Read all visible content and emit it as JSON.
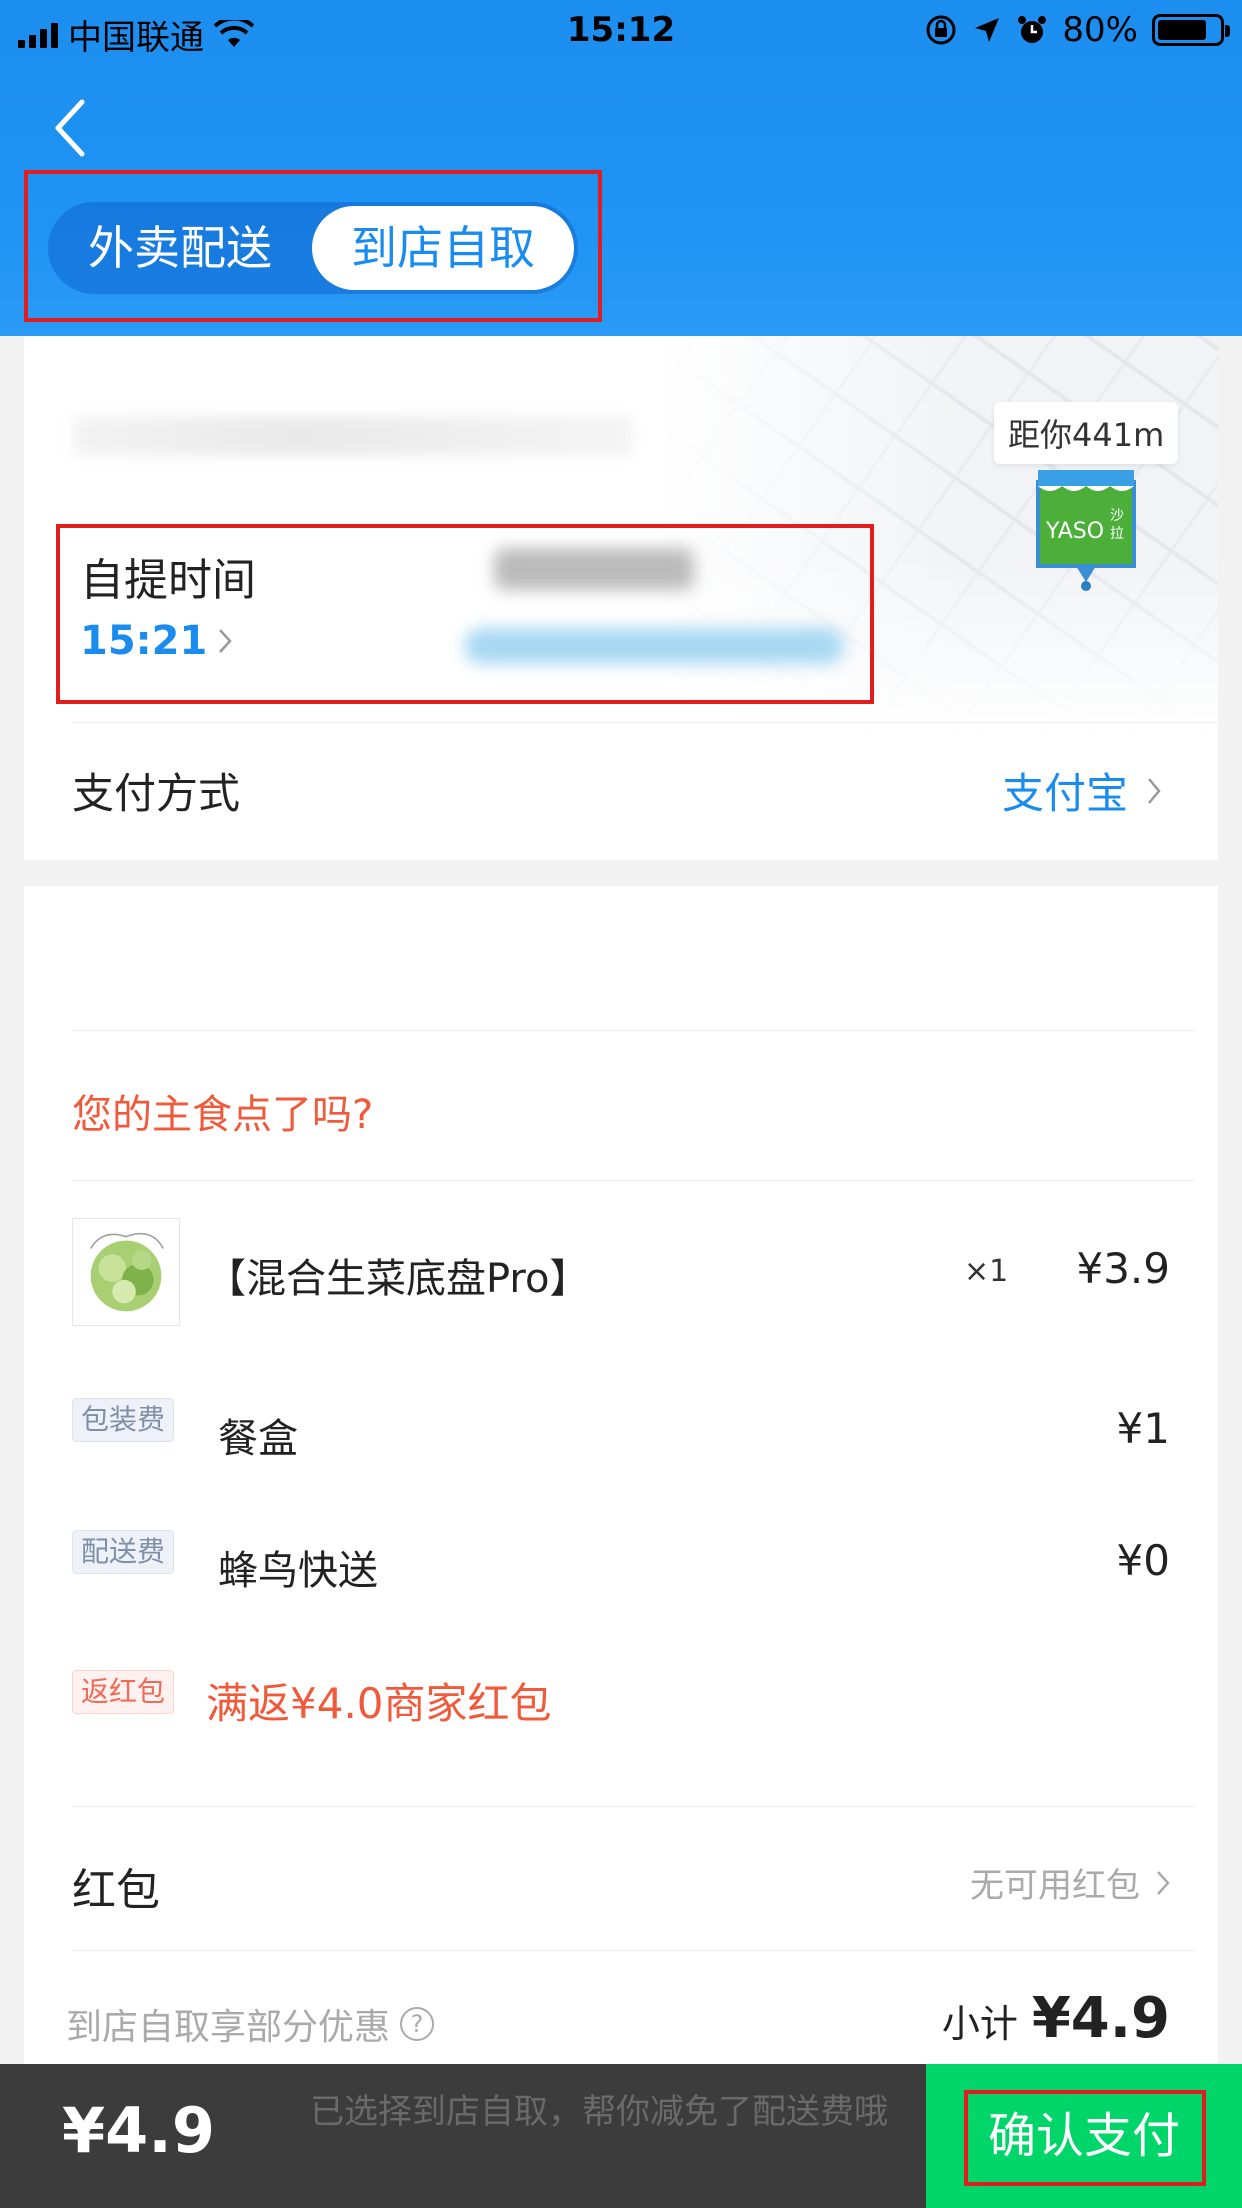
{
  "status_bar": {
    "carrier": "中国联通",
    "time": "15:12",
    "battery": "80%",
    "battery_level": 0.8
  },
  "mode_toggle": {
    "delivery": "外卖配送",
    "pickup": "到店自取",
    "selected": "pickup"
  },
  "store": {
    "distance": "距你441m",
    "logo_text": "YASO",
    "logo_tag": "沙拉"
  },
  "pickup": {
    "label": "自提时间",
    "time": "15:21"
  },
  "payment": {
    "label": "支付方式",
    "method": "支付宝"
  },
  "prompt": "您的主食点了吗?",
  "item": {
    "name": "【混合生菜底盘Pro】",
    "qty": "×1",
    "price": "¥3.9"
  },
  "fees": [
    {
      "tag": "包装费",
      "name": "餐盒",
      "price": "¥1"
    },
    {
      "tag": "配送费",
      "name": "蜂鸟快送",
      "price": "¥0"
    }
  ],
  "rebate": {
    "tag": "返红包",
    "text": "满返¥4.0商家红包"
  },
  "red_packet": {
    "label": "红包",
    "value": "无可用红包"
  },
  "promo_note": "到店自取享部分优惠",
  "subtotal": {
    "label": "小计",
    "value": "¥4.9"
  },
  "bottom_bar": {
    "total": "¥4.9",
    "hint": "已选择到店自取，帮你减免了配送费哦",
    "confirm": "确认支付"
  },
  "colors": {
    "primary_blue": "#1a8cf0",
    "accent_red": "#f05a3a",
    "confirm_green": "#00d56a",
    "highlight_red": "#e11d1d"
  }
}
